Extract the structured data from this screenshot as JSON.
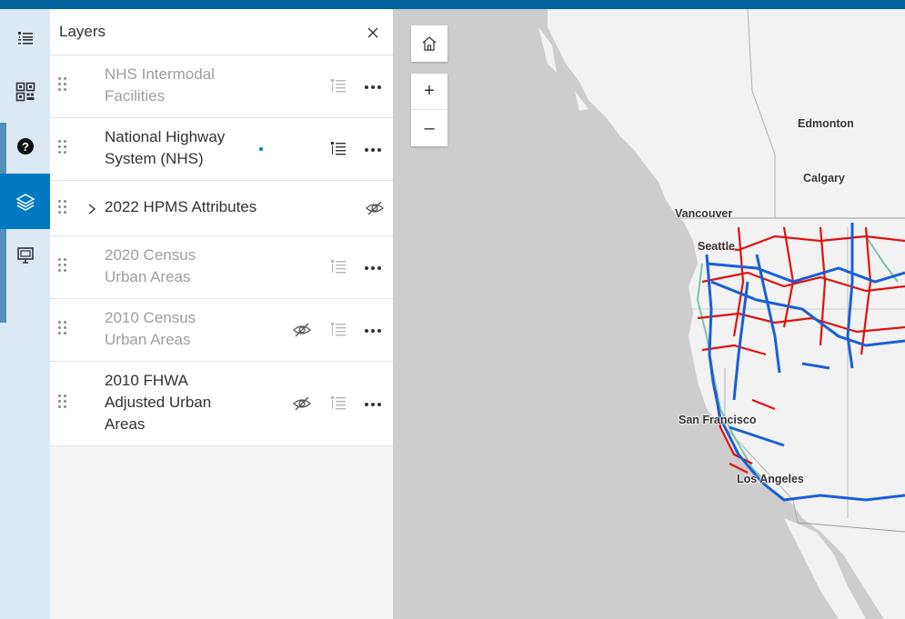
{
  "panel": {
    "title": "Layers",
    "close_icon": "close-icon"
  },
  "rail": {
    "items": [
      {
        "name": "legend",
        "icon": "list-icon",
        "active": false
      },
      {
        "name": "basemap",
        "icon": "qr-grid-icon",
        "active": false
      },
      {
        "name": "help",
        "icon": "question-icon",
        "active": false
      },
      {
        "name": "layers",
        "icon": "layers-icon",
        "active": true
      },
      {
        "name": "slides",
        "icon": "presentation-icon",
        "active": false
      }
    ]
  },
  "layers": [
    {
      "line1": "NHS Intermodal",
      "line2": "Facilities",
      "line3": "",
      "dimmed": true,
      "hidden_eye": false,
      "expandable": false,
      "legend": true,
      "more": true,
      "updating": false
    },
    {
      "line1": "National Highway",
      "line2": "System (NHS)",
      "line3": "",
      "dimmed": false,
      "hidden_eye": false,
      "expandable": false,
      "legend": true,
      "more": true,
      "updating": true
    },
    {
      "line1": "2022 HPMS Attributes",
      "line2": "",
      "line3": "",
      "dimmed": false,
      "hidden_eye": true,
      "expandable": true,
      "legend": false,
      "more": false,
      "updating": false
    },
    {
      "line1": "2020 Census",
      "line2": "Urban Areas",
      "line3": "",
      "dimmed": true,
      "hidden_eye": false,
      "expandable": false,
      "legend": true,
      "more": true,
      "updating": false
    },
    {
      "line1": "2010 Census",
      "line2": "Urban Areas",
      "line3": "",
      "dimmed": true,
      "hidden_eye": true,
      "expandable": false,
      "legend": true,
      "more": true,
      "updating": false
    },
    {
      "line1": "2010 FHWA",
      "line2": "Adjusted Urban",
      "line3": "Areas",
      "dimmed": false,
      "hidden_eye": true,
      "expandable": false,
      "legend": true,
      "more": true,
      "updating": false
    }
  ],
  "map": {
    "controls": {
      "home_icon": "home-icon",
      "zoom_in": "+",
      "zoom_out": "–"
    },
    "cities": {
      "edmonton": "Edmonton",
      "calgary": "Calgary",
      "vancouver": "Vancouver",
      "seattle": "Seattle",
      "san_francisco": "San Francisco",
      "los_angeles": "Los Angeles"
    },
    "colors": {
      "water": "#cdcdcd",
      "land": "#f2f2f2",
      "nhs_interstate": "#1a5fd6",
      "nhs_other": "#e01010",
      "strahnet": "#7cc3a7"
    }
  }
}
